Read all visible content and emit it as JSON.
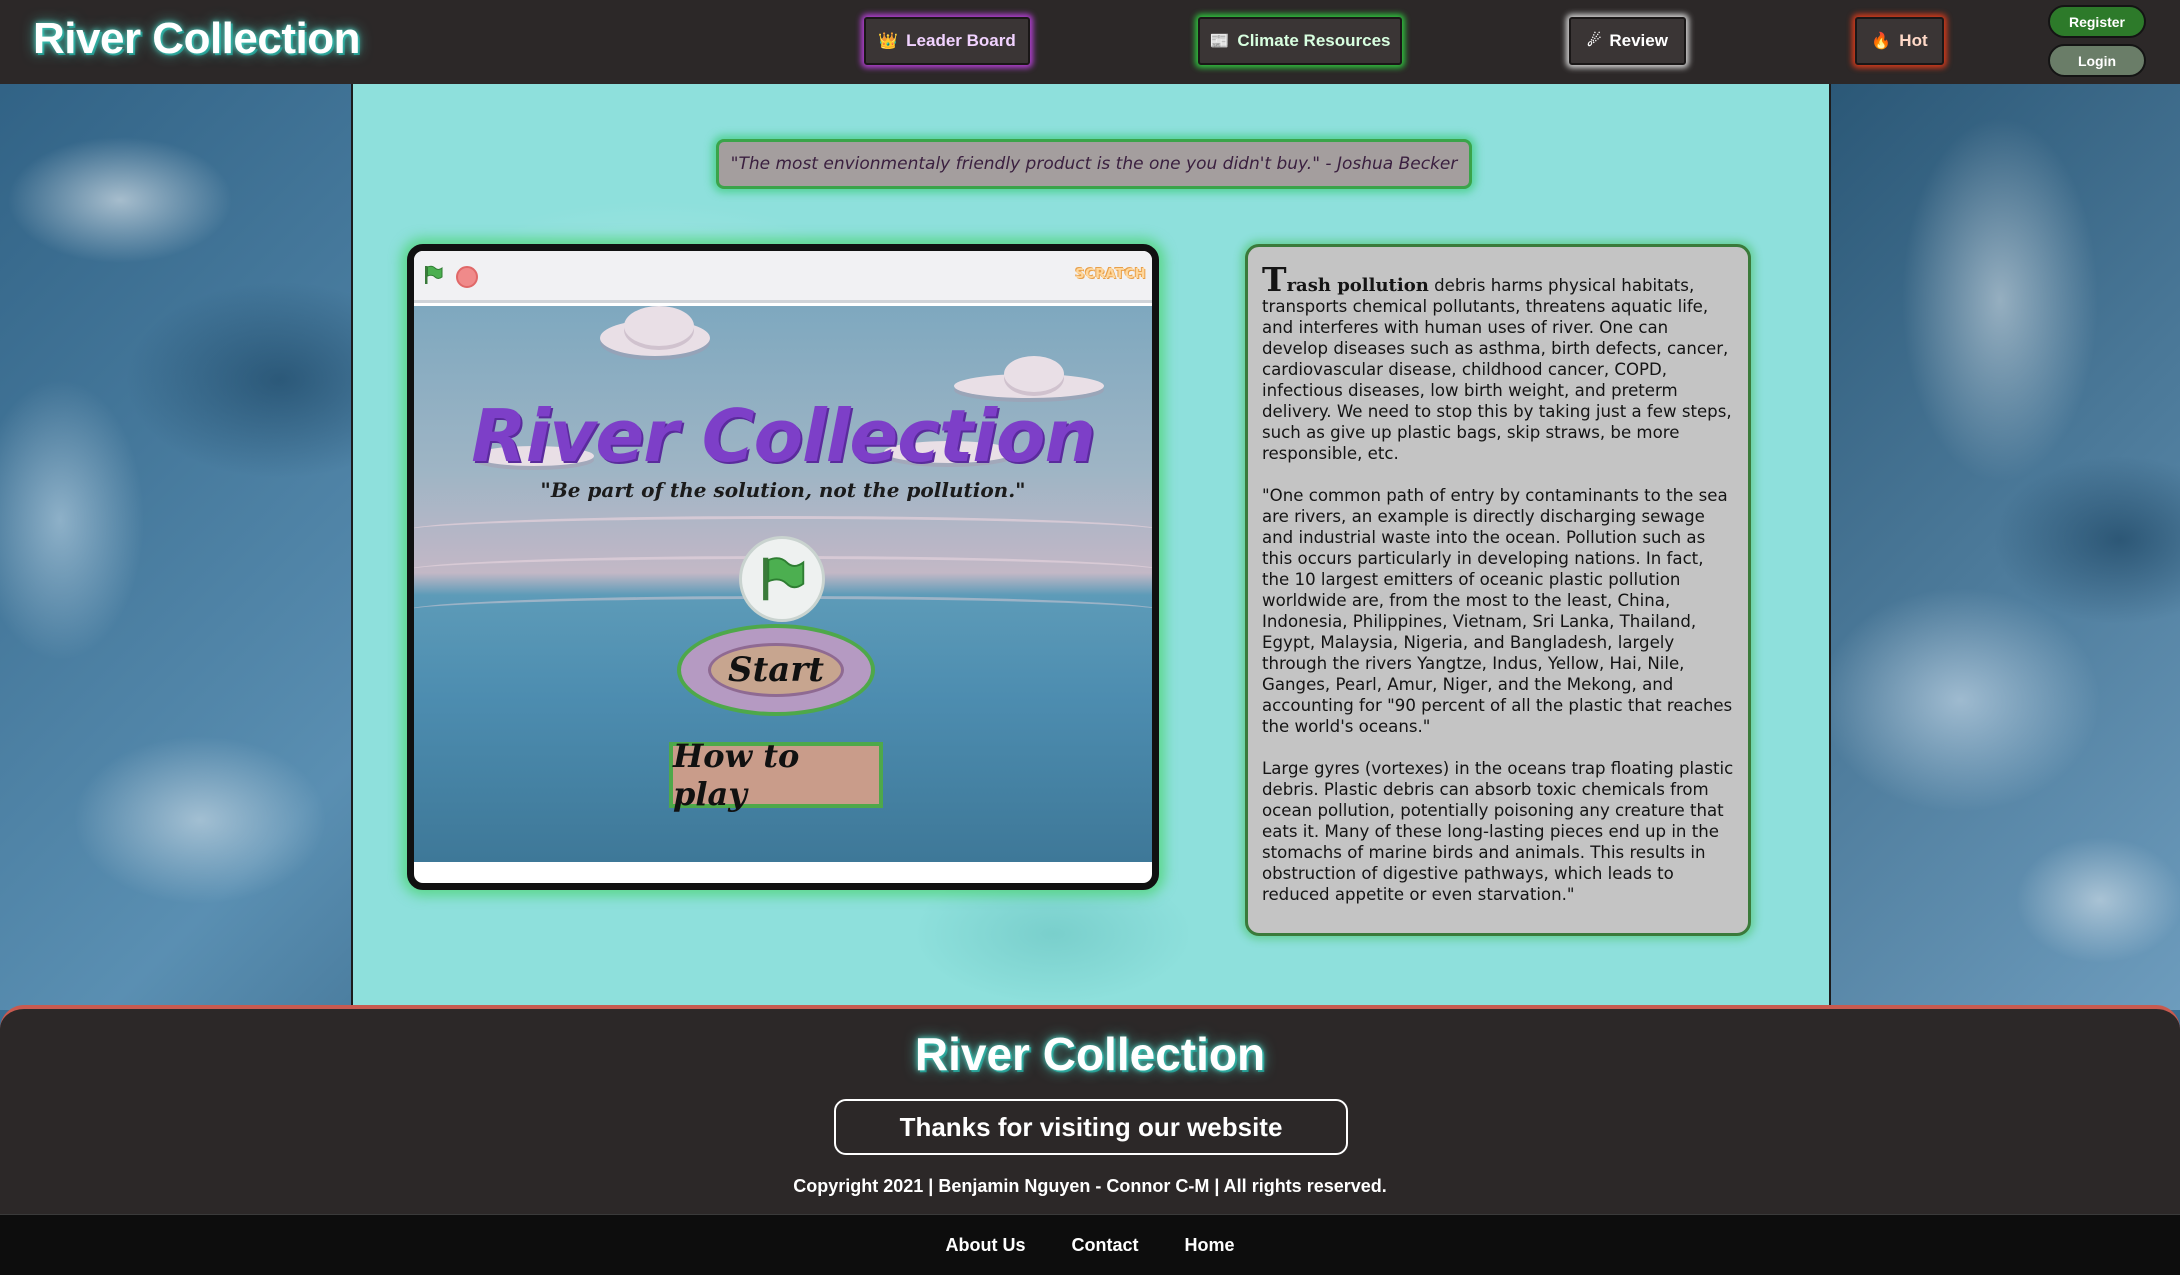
{
  "header": {
    "brand": "River Collection",
    "nav": [
      {
        "label": "Leader Board",
        "icon": "crown-icon",
        "glyph": "👑",
        "glow": "#b03fd0"
      },
      {
        "label": "Climate Resources",
        "icon": "newspaper-icon",
        "glyph": "📰",
        "glow": "#2fbf3d"
      },
      {
        "label": "Review",
        "icon": "comet-icon",
        "glyph": "☄",
        "glow": "#cfcfcf"
      },
      {
        "label": "Hot",
        "icon": "fire-icon",
        "glyph": "🔥",
        "glow": "#d23a1c"
      }
    ],
    "register_label": "Register",
    "login_label": "Login"
  },
  "quote": {
    "text": "\"The most envionmentaly friendly product is the one you didn't buy.\" - Joshua Becker"
  },
  "game": {
    "scratch_logo": "SCRATCH",
    "title": "River Collection",
    "subtitle": "\"Be part of the solution, not the pollution.\"",
    "start_label": "Start",
    "howto_label": "How to play"
  },
  "info": {
    "drop_cap": "T",
    "lead": "rash pollution",
    "p1_rest": " debris harms physical habitats, transports chemical pollutants, threatens aquatic life, and interferes with human uses of river. One can develop diseases such as asthma, birth defects, cancer, cardiovascular disease, childhood cancer, COPD, infectious diseases, low birth weight, and preterm delivery. We need to stop this by taking just a few steps, such as give up plastic bags, skip straws, be more responsible, etc.",
    "p2": "\"One common path of entry by contaminants to the sea are rivers, an example is directly discharging sewage and industrial waste into the ocean. Pollution such as this occurs particularly in developing nations. In fact, the 10 largest emitters of oceanic plastic pollution worldwide are, from the most to the least, China, Indonesia, Philippines, Vietnam, Sri Lanka, Thailand, Egypt, Malaysia, Nigeria, and Bangladesh, largely through the rivers Yangtze, Indus, Yellow, Hai, Nile, Ganges, Pearl, Amur, Niger, and the Mekong, and accounting for \"90 percent of all the plastic that reaches the world's oceans.\"",
    "p3": "Large gyres (vortexes) in the oceans trap floating plastic debris. Plastic debris can absorb toxic chemicals from ocean pollution, potentially poisoning any creature that eats it. Many of these long-lasting pieces end up in the stomachs of marine birds and animals. This results in obstruction of digestive pathways, which leads to reduced appetite or even starvation.\""
  },
  "footer": {
    "brand": "River Collection",
    "thanks": "Thanks for visiting our website",
    "copyright": "Copyright 2021 | Benjamin Nguyen - Connor C-M | All rights reserved.",
    "links": [
      "About Us",
      "Contact",
      "Home"
    ]
  },
  "colors": {
    "header_bg": "#2c2828",
    "panel_bg": "#8ee0dc",
    "accent_green": "#3aa44a",
    "title_purple": "#7d3fc8"
  }
}
